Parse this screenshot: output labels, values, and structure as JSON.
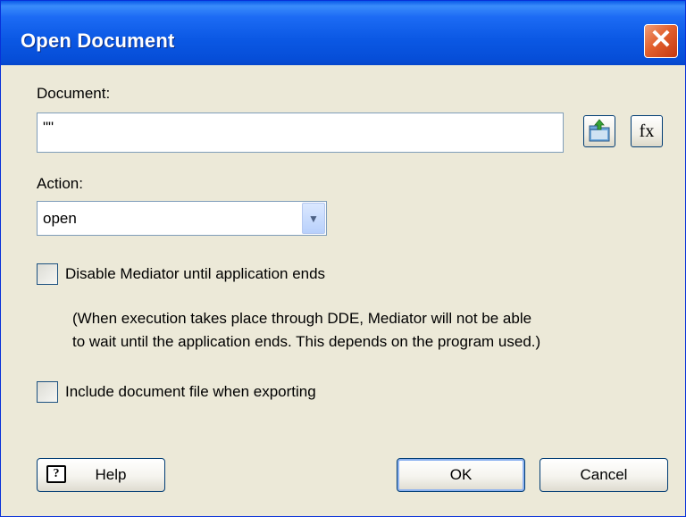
{
  "window": {
    "title": "Open Document",
    "close_icon_glyph": "✕"
  },
  "document": {
    "label": "Document:",
    "value": "\"\""
  },
  "buttons": {
    "browse_icon": "folder-browse-icon",
    "fx_label": "fx",
    "help_label": "Help",
    "help_glyph": "?",
    "ok_label": "OK",
    "cancel_label": "Cancel"
  },
  "action": {
    "label": "Action:",
    "value": "open",
    "arrow_glyph": "▼"
  },
  "options": {
    "disable_mediator": {
      "label": "Disable Mediator until application ends",
      "checked": false
    },
    "note_line1": "(When execution takes place through DDE, Mediator will not be able",
    "note_line2": "to wait until the application ends. This depends on the program used.)",
    "include_doc": {
      "label": "Include document file when exporting",
      "checked": false
    }
  }
}
